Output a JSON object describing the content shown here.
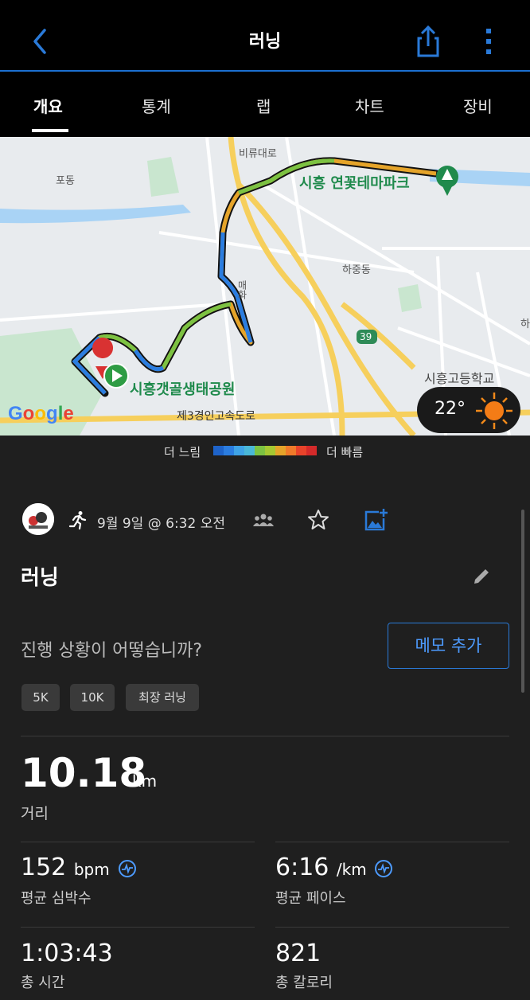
{
  "header": {
    "title": "러닝"
  },
  "tabs": [
    {
      "label": "개요"
    },
    {
      "label": "통계"
    },
    {
      "label": "랩"
    },
    {
      "label": "차트"
    },
    {
      "label": "장비"
    }
  ],
  "map": {
    "labels": {
      "biryu": "비류대로",
      "podong": "포동",
      "hajung": "하중동",
      "road39": "39",
      "gyeongin": "제3경인고속도로",
      "ha": "하",
      "school": "시흥고등학교",
      "park_lotus": "시흥 연꽃테마파크",
      "park_tidal": "시흥갯골생태공원",
      "vertical_road": "매화",
      "google": "Google"
    },
    "weather": {
      "temperature": "22°"
    }
  },
  "legend": {
    "slow": "더 느림",
    "fast": "더 빠름",
    "colors": [
      "#1e63c9",
      "#2b7de0",
      "#3fa3e6",
      "#4ab8d8",
      "#7cc242",
      "#a6c832",
      "#e5a42a",
      "#f07a2a",
      "#e8432a",
      "#d42a2a"
    ]
  },
  "activity": {
    "datetime": "9월 9일 @ 6:32 오전",
    "name": "러닝",
    "question": "진행 상황이 어떻습니까?",
    "memo_button": "메모 추가",
    "chips": [
      "5K",
      "10K",
      "최장 러닝"
    ]
  },
  "stats": {
    "distance": {
      "value": "10.18",
      "unit": "km",
      "label": "거리"
    },
    "heart_rate": {
      "value": "152",
      "unit": "bpm",
      "label": "평균 심박수"
    },
    "pace": {
      "value": "6:16",
      "unit": "/km",
      "label": "평균 페이스"
    },
    "time": {
      "value": "1:03:43",
      "label": "총 시간"
    },
    "calories": {
      "value": "821",
      "label": "총 칼로리"
    }
  },
  "colors": {
    "accent": "#1b6fd0",
    "link": "#4d9bff",
    "park_green": "#1f8a4c"
  }
}
